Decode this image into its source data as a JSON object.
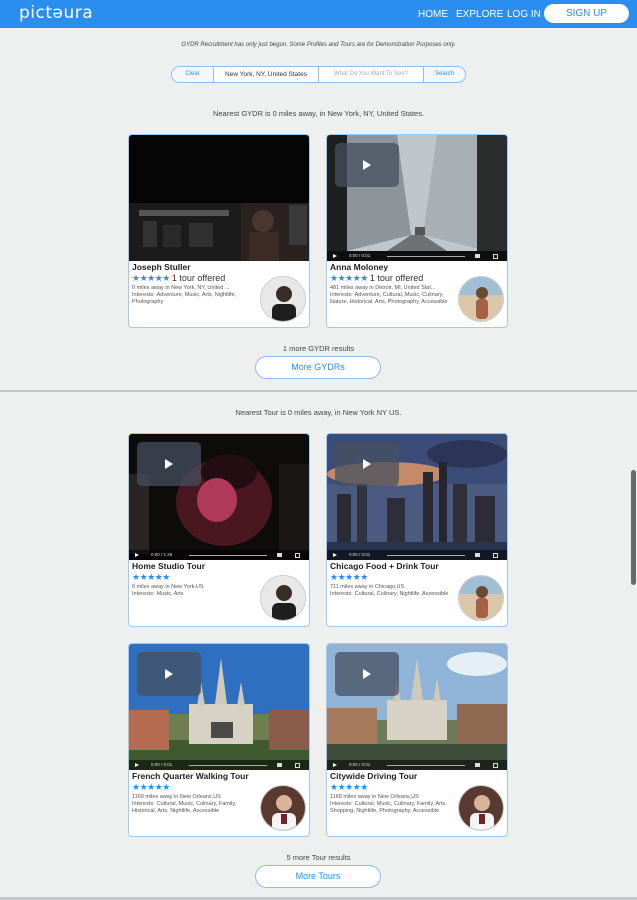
{
  "header": {
    "logo": "pictəura",
    "nav": {
      "home": "HOME",
      "explore": "EXPLORE",
      "login": "LOG IN"
    },
    "signup": "SIGN UP",
    "brand_color": "#2a8df0"
  },
  "notice": "GYDR Recruitment has only just begun. Some Profiles and Tours are for Demonstration Purposes only.",
  "search": {
    "clear": "Clear",
    "location": "New York, NY, United States",
    "what_placeholder": "What Do You Want To See?",
    "button": "Search"
  },
  "gydrs": {
    "nearest": "Nearest GYDR is 0 miles away, in New York, NY, United States.",
    "cards": [
      {
        "name": "Joseph Stuller",
        "stars": "★★★★★",
        "offered": "1 tour offered",
        "distance": "0 miles away in New York, NY, United ...",
        "interests_label": "Interests:",
        "interests": "Adventure, Music, Arts, Nightlife, Photography"
      },
      {
        "name": "Anna Moloney",
        "stars": "★★★★★",
        "offered": "1 tour offered",
        "distance": "481 miles away in Detroit, MI, United Stat...",
        "interests_label": "Interests:",
        "interests": "Adventure, Cultural, Music, Culinary, Nature, Historical, Arts, Photography, Accessible",
        "video_time": "0:00  /  0:01"
      }
    ],
    "more_count": "1 more GYDR results",
    "more_button": "More GYDRs"
  },
  "tours": {
    "nearest": "Nearest Tour is 0 miles away, in New York NY US.",
    "cards": [
      {
        "name": "Home Studio Tour",
        "stars": "★★★★★",
        "distance": "0 miles away in New York,US",
        "interests_label": "Interests:",
        "interests": "Music, Arts",
        "video_time": "0:00  /  1:28"
      },
      {
        "name": "Chicago Food + Drink Tour",
        "stars": "★★★★★",
        "distance": "711 miles away in Chicago,US",
        "interests_label": "Interests:",
        "interests": "Cultural, Culinary, Nightlife, Accessible",
        "video_time": "0:00  /  0:01"
      },
      {
        "name": "French Quarter Walking Tour",
        "stars": "★★★★★",
        "distance": "1169 miles away in New Orleans,US",
        "interests_label": "Interests:",
        "interests": "Cultural, Music, Culinary, Family, Historical, Arts, Nightlife, Accessible",
        "video_time": "0:00  /  0:01"
      },
      {
        "name": "Citywide Driving Tour",
        "stars": "★★★★★",
        "distance": "1169 miles away in New Orleans,US",
        "interests_label": "Interests:",
        "interests": "Cultural, Music, Culinary, Family, Arts, Shopping, Nightlife, Photography, Accessible",
        "video_time": "0:00  /  0:01"
      }
    ],
    "more_count": "5 more Tour results",
    "more_button": "More Tours"
  }
}
